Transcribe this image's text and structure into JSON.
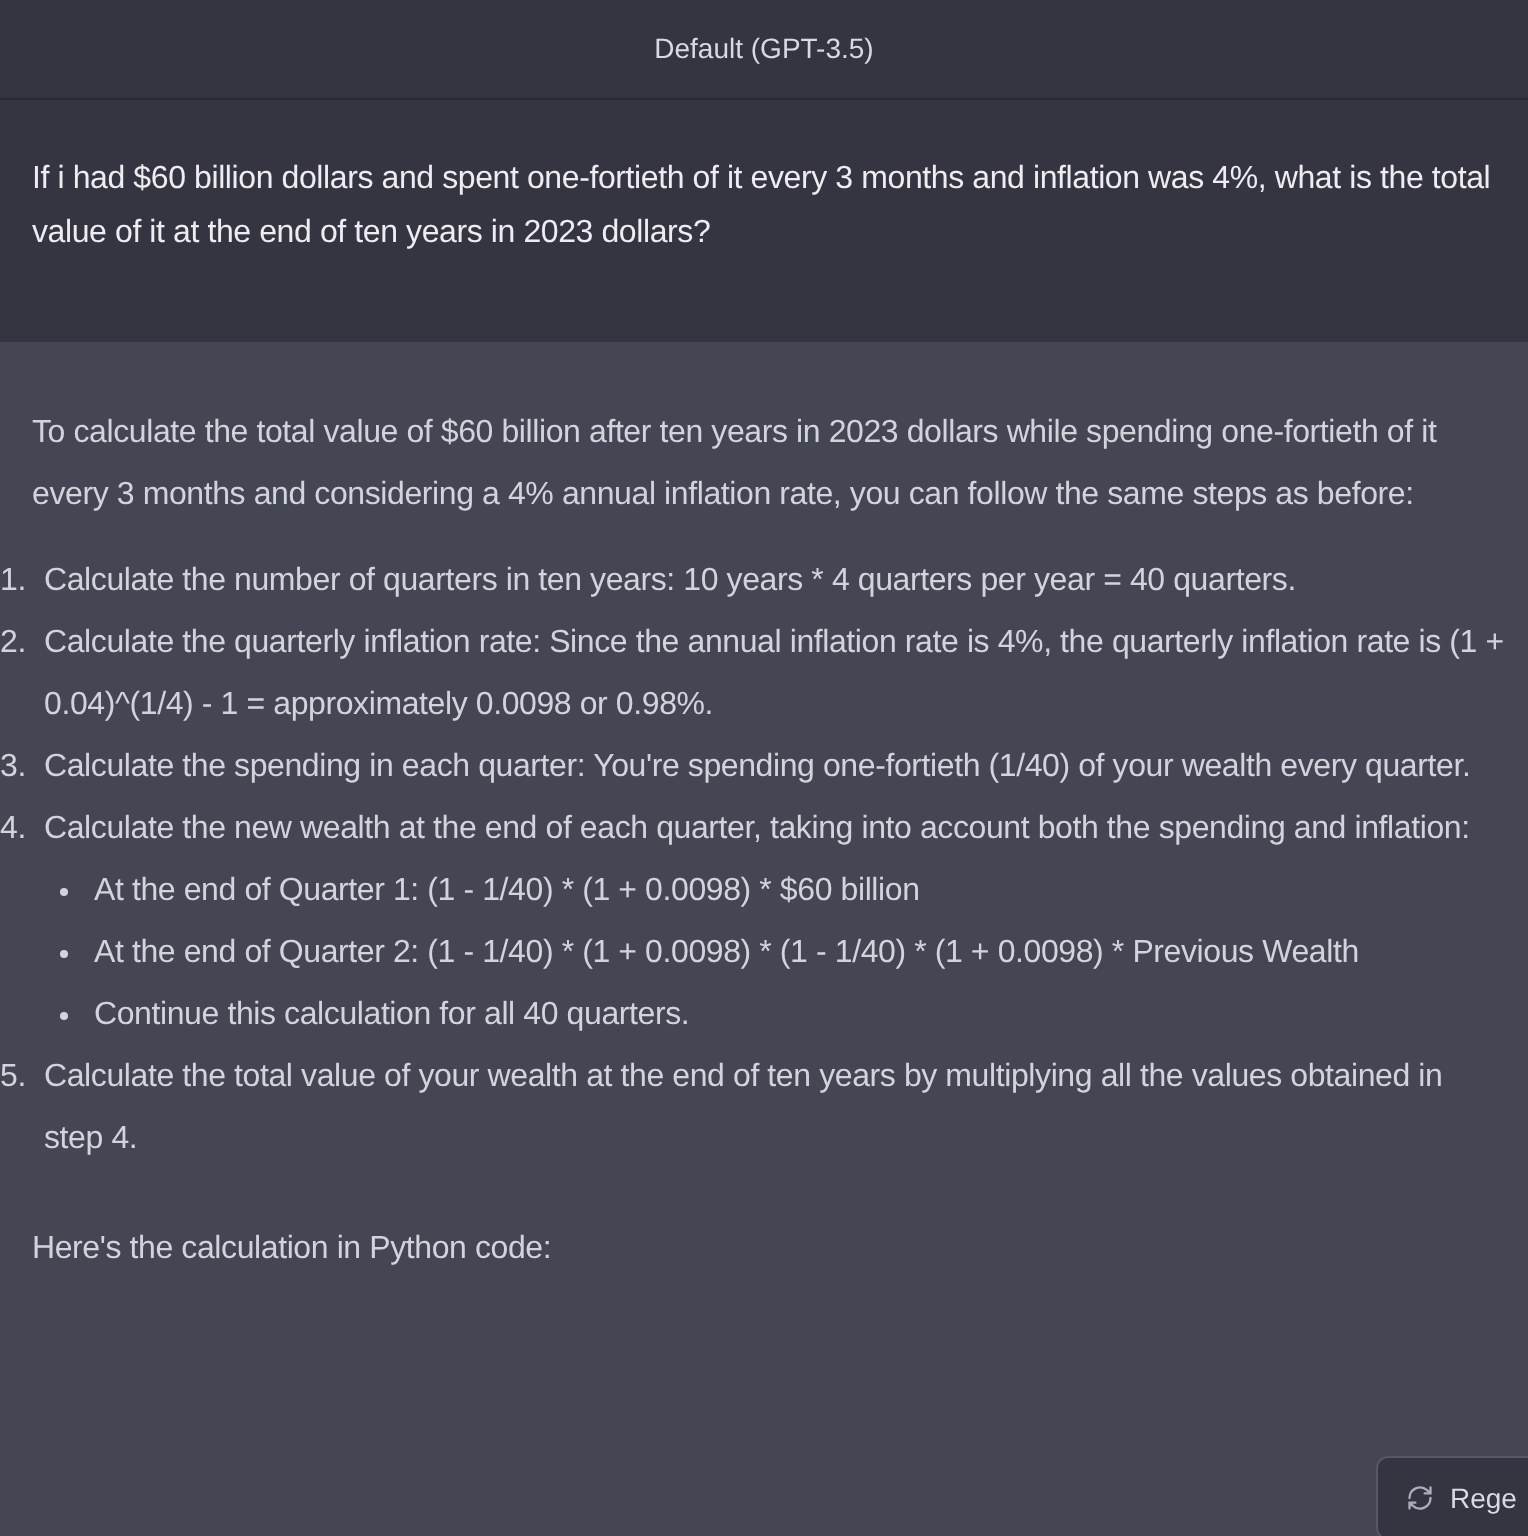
{
  "header": {
    "title": "Default (GPT-3.5)"
  },
  "user_message": "If i had $60 billion dollars and spent one-fortieth of it every 3 months and inflation was 4%, what is the total value of it at the end of ten years in 2023 dollars?",
  "assistant_message": {
    "intro": "To calculate the total value of $60 billion after ten years in 2023 dollars while spending one-fortieth of it every 3 months and considering a 4% annual inflation rate, you can follow the same steps as before:",
    "steps": [
      {
        "number": "1.",
        "text": "Calculate the number of quarters in ten years: 10 years * 4 quarters per year = 40 quarters."
      },
      {
        "number": "2.",
        "text": "Calculate the quarterly inflation rate: Since the annual inflation rate is 4%, the quarterly inflation rate is (1 + 0.04)^(1/4) - 1 = approximately 0.0098 or 0.98%."
      },
      {
        "number": "3.",
        "text": "Calculate the spending in each quarter: You're spending one-fortieth (1/40) of your wealth every quarter."
      },
      {
        "number": "4.",
        "text": "Calculate the new wealth at the end of each quarter, taking into account both the spending and inflation:",
        "children": [
          {
            "text": "At the end of Quarter 1: (1 - 1/40) * (1 + 0.0098) * $60 billion"
          },
          {
            "text": "At the end of Quarter 2: (1 - 1/40) * (1 + 0.0098) * (1 - 1/40) * (1 + 0.0098) * Previous Wealth"
          },
          {
            "text": "Continue this calculation for all 40 quarters."
          }
        ]
      },
      {
        "number": "5.",
        "text": "Calculate the total value of your wealth at the end of ten years by multiplying all the values obtained in step 4."
      }
    ],
    "outro": "Here's the calculation in Python code:"
  },
  "regenerate_button": {
    "label": "Rege"
  }
}
